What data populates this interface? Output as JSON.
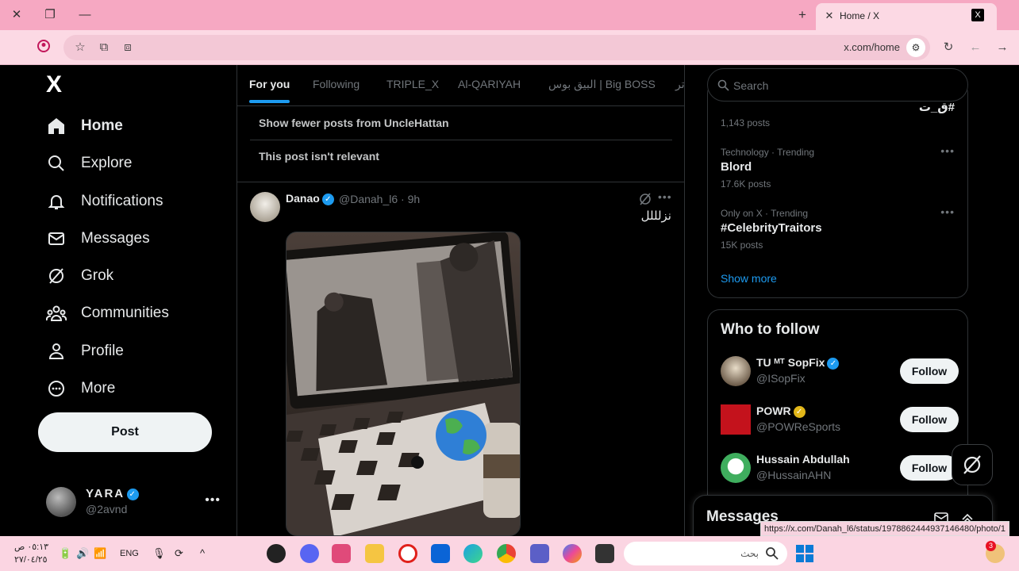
{
  "browser": {
    "tab_title": "Home / X",
    "tab_icon": "x-logo-icon",
    "url": "x.com/home",
    "status_link": "https://x.com/Danah_l6/status/1978862444937146480/photo/1"
  },
  "nav": {
    "logo": "X",
    "items": [
      {
        "label": "Home",
        "icon": "home-icon"
      },
      {
        "label": "Explore",
        "icon": "search-icon"
      },
      {
        "label": "Notifications",
        "icon": "bell-icon"
      },
      {
        "label": "Messages",
        "icon": "envelope-icon"
      },
      {
        "label": "Grok",
        "icon": "grok-icon"
      },
      {
        "label": "Communities",
        "icon": "communities-icon"
      },
      {
        "label": "Profile",
        "icon": "person-icon"
      },
      {
        "label": "More",
        "icon": "more-circle-icon"
      }
    ],
    "post_label": "Post",
    "account": {
      "name": "YARA",
      "handle": "@2avnd"
    }
  },
  "feed": {
    "tabs": [
      "For you",
      "Following",
      "TRIPLE_X",
      "Al-QARIYAH",
      "البيق بوس | Big BOSS",
      "تر"
    ],
    "active_tab": 0,
    "menu_options": [
      "Show fewer posts from UncleHattan",
      "This post isn't relevant"
    ],
    "post": {
      "name": "Danao",
      "handle": "@Danah_l6 · 9h",
      "text": "نزلللل"
    }
  },
  "sidebar": {
    "search_placeholder": "Search",
    "partial_trend": {
      "title": "#ق_ت",
      "posts": "1,143 posts"
    },
    "trends": [
      {
        "meta": "Technology · Trending",
        "title": "Blord",
        "posts": "17.6K posts"
      },
      {
        "meta": "Only on X · Trending",
        "title": "#CelebrityTraitors",
        "posts": "15K posts"
      }
    ],
    "show_more": "Show more",
    "who_to_follow": {
      "title": "Who to follow",
      "follow_label": "Follow",
      "accounts": [
        {
          "name": "TU ᴹᵀ SopFix",
          "handle": "@ISopFix",
          "badge": "blue"
        },
        {
          "name": "POWR",
          "handle": "@POWReSports",
          "badge": "gold"
        },
        {
          "name": "Hussain Abdullah",
          "handle": "@HussainAHN",
          "badge": "none"
        }
      ]
    },
    "messages_title": "Messages"
  },
  "taskbar": {
    "time": "٠٥:١٣ ص",
    "date": "٢٧/٠٤/٢٥",
    "lang": "ENG",
    "search_placeholder": "بحث",
    "badge_count": "3"
  },
  "colors": {
    "accent": "#1d9bf0",
    "chrome": "#f6a8c2",
    "page_bg": "#000000"
  }
}
